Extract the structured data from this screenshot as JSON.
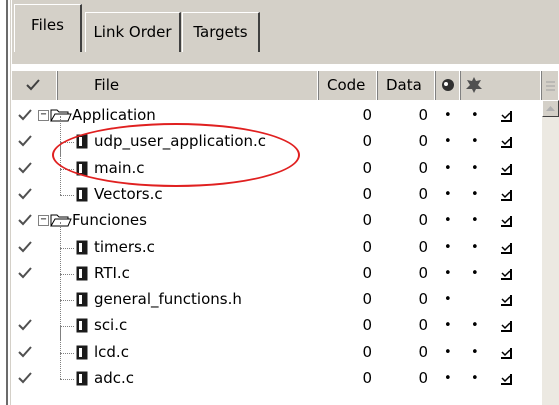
{
  "tabs": [
    {
      "label": "Files",
      "active": true
    },
    {
      "label": "Link Order",
      "active": false
    },
    {
      "label": "Targets",
      "active": false
    }
  ],
  "columns": {
    "check_icon": "checkmark-icon",
    "file": "File",
    "code": "Code",
    "data": "Data",
    "debug_icon": "bug-icon",
    "target_icon": "gear-icon"
  },
  "rows": [
    {
      "type": "group",
      "name": "Application",
      "code": "0",
      "data": "0",
      "checked": true,
      "dot1": true,
      "dot2": true,
      "mark": true
    },
    {
      "type": "file",
      "name": "udp_user_application.c",
      "code": "0",
      "data": "0",
      "checked": true,
      "dot1": true,
      "dot2": true,
      "mark": true
    },
    {
      "type": "file",
      "name": "main.c",
      "code": "0",
      "data": "0",
      "checked": true,
      "dot1": true,
      "dot2": true,
      "mark": true
    },
    {
      "type": "file",
      "name": "Vectors.c",
      "code": "0",
      "data": "0",
      "checked": true,
      "dot1": true,
      "dot2": true,
      "mark": true
    },
    {
      "type": "group",
      "name": "Funciones",
      "code": "0",
      "data": "0",
      "checked": true,
      "dot1": true,
      "dot2": true,
      "mark": true
    },
    {
      "type": "file",
      "name": "timers.c",
      "code": "0",
      "data": "0",
      "checked": true,
      "dot1": true,
      "dot2": true,
      "mark": true
    },
    {
      "type": "file",
      "name": "RTI.c",
      "code": "0",
      "data": "0",
      "checked": true,
      "dot1": true,
      "dot2": true,
      "mark": true
    },
    {
      "type": "file",
      "name": "general_functions.h",
      "code": "0",
      "data": "0",
      "checked": false,
      "dot1": true,
      "dot2": false,
      "mark": true
    },
    {
      "type": "file",
      "name": "sci.c",
      "code": "0",
      "data": "0",
      "checked": true,
      "dot1": true,
      "dot2": true,
      "mark": true
    },
    {
      "type": "file",
      "name": "lcd.c",
      "code": "0",
      "data": "0",
      "checked": true,
      "dot1": true,
      "dot2": true,
      "mark": true
    },
    {
      "type": "file",
      "name": "adc.c",
      "code": "0",
      "data": "0",
      "checked": true,
      "dot1": true,
      "dot2": true,
      "mark": true
    }
  ],
  "colors": {
    "highlight": "#e02020",
    "panel": "#d4d0c8"
  }
}
